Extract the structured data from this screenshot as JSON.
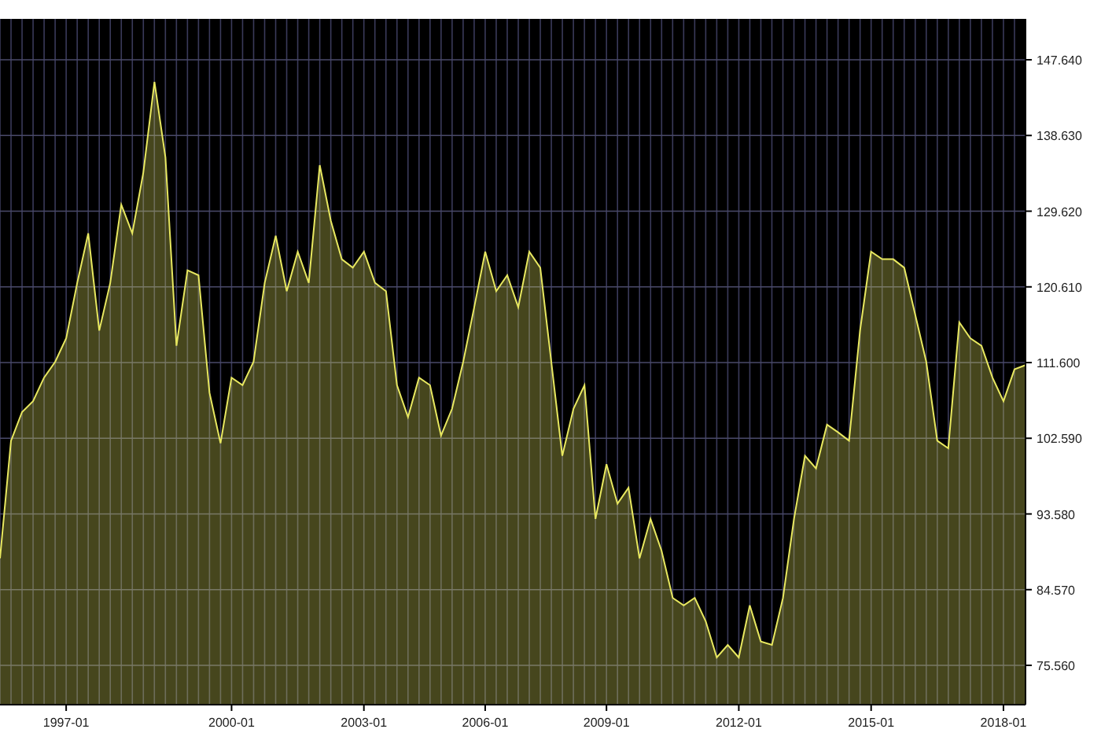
{
  "chart_data": {
    "type": "area",
    "grid": true,
    "ylim": [
      70.88,
      152.51
    ],
    "categories": [
      null,
      null,
      null,
      null,
      null,
      null,
      "1997-01",
      null,
      null,
      null,
      null,
      null,
      null,
      null,
      null,
      null,
      null,
      null,
      null,
      null,
      null,
      "2000-01",
      null,
      null,
      null,
      null,
      null,
      null,
      null,
      null,
      null,
      null,
      null,
      "2003-01",
      null,
      null,
      null,
      null,
      null,
      null,
      null,
      null,
      null,
      null,
      "2006-01",
      null,
      null,
      null,
      null,
      null,
      null,
      null,
      null,
      null,
      null,
      "2009-01",
      null,
      null,
      null,
      null,
      null,
      null,
      null,
      null,
      null,
      null,
      null,
      "2012-01",
      null,
      null,
      null,
      null,
      null,
      null,
      null,
      null,
      null,
      null,
      null,
      "2015-01",
      null,
      null,
      null,
      null,
      null,
      null,
      null,
      null,
      null,
      null,
      null,
      "2018-01",
      null,
      null
    ],
    "yticks": [
      {
        "value": 75.56,
        "label": "75.560"
      },
      {
        "value": 84.57,
        "label": "84.570"
      },
      {
        "value": 93.58,
        "label": "93.580"
      },
      {
        "value": 102.59,
        "label": "102.590"
      },
      {
        "value": 111.6,
        "label": "111.600"
      },
      {
        "value": 120.61,
        "label": "120.610"
      },
      {
        "value": 129.62,
        "label": "129.620"
      },
      {
        "value": 138.63,
        "label": "138.630"
      },
      {
        "value": 147.64,
        "label": "147.640"
      }
    ],
    "series": [
      {
        "color": "#e8e860",
        "values": [
          88.3,
          102.3,
          105.7,
          107.0,
          109.8,
          111.7,
          114.5,
          121.1,
          127.0,
          115.4,
          121.1,
          130.4,
          127.0,
          134.2,
          145.0,
          136.0,
          113.6,
          122.6,
          122.0,
          108.0,
          102.0,
          109.8,
          108.9,
          111.7,
          121.1,
          126.7,
          120.1,
          124.8,
          121.1,
          135.1,
          128.5,
          123.9,
          122.9,
          124.8,
          121.1,
          120.1,
          108.9,
          105.1,
          109.8,
          108.9,
          102.9,
          106.1,
          111.7,
          118.2,
          124.8,
          120.1,
          122.0,
          118.2,
          124.8,
          122.9,
          111.7,
          100.5,
          106.1,
          108.9,
          93.0,
          99.5,
          94.8,
          96.7,
          88.3,
          93.0,
          89.2,
          83.6,
          82.7,
          83.6,
          80.8,
          76.5,
          78.0,
          76.5,
          82.7,
          78.4,
          78.0,
          83.6,
          93.0,
          100.5,
          99.0,
          104.2,
          103.3,
          102.3,
          115.4,
          124.8,
          123.9,
          123.9,
          122.9,
          117.3,
          111.7,
          102.3,
          101.4,
          116.4,
          114.5,
          113.6,
          109.8,
          107.0,
          110.8,
          111.3
        ]
      }
    ]
  }
}
